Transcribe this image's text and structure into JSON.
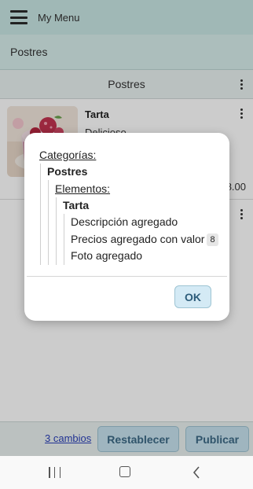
{
  "appbar": {
    "title": "My Menu",
    "menu_icon": "hamburger-icon"
  },
  "breadcrumb": {
    "label": "Postres"
  },
  "section": {
    "title": "Postres",
    "more_icon": "more-vertical-icon"
  },
  "items": [
    {
      "name": "Tarta",
      "description": "Delicioso",
      "price": "8.00",
      "image": "cake-photo"
    }
  ],
  "footer": {
    "changes_link": "3 cambios",
    "reset_label": "Restablecer",
    "publish_label": "Publicar"
  },
  "dialog": {
    "categories_label": "Categorías:",
    "category_name": "Postres",
    "elements_label": "Elementos:",
    "element_name": "Tarta",
    "changes": [
      {
        "text": "Descripción agregado"
      },
      {
        "text": "Precios agregado con valor",
        "badge": "8"
      },
      {
        "text": "Foto agregado"
      }
    ],
    "ok_label": "OK"
  },
  "navbar": {
    "icons": [
      "recents-icon",
      "home-icon",
      "back-icon"
    ]
  },
  "colors": {
    "appbar": "#c9e6e4",
    "accent_button": "#c7e3ef",
    "link": "#2a3fb8"
  }
}
